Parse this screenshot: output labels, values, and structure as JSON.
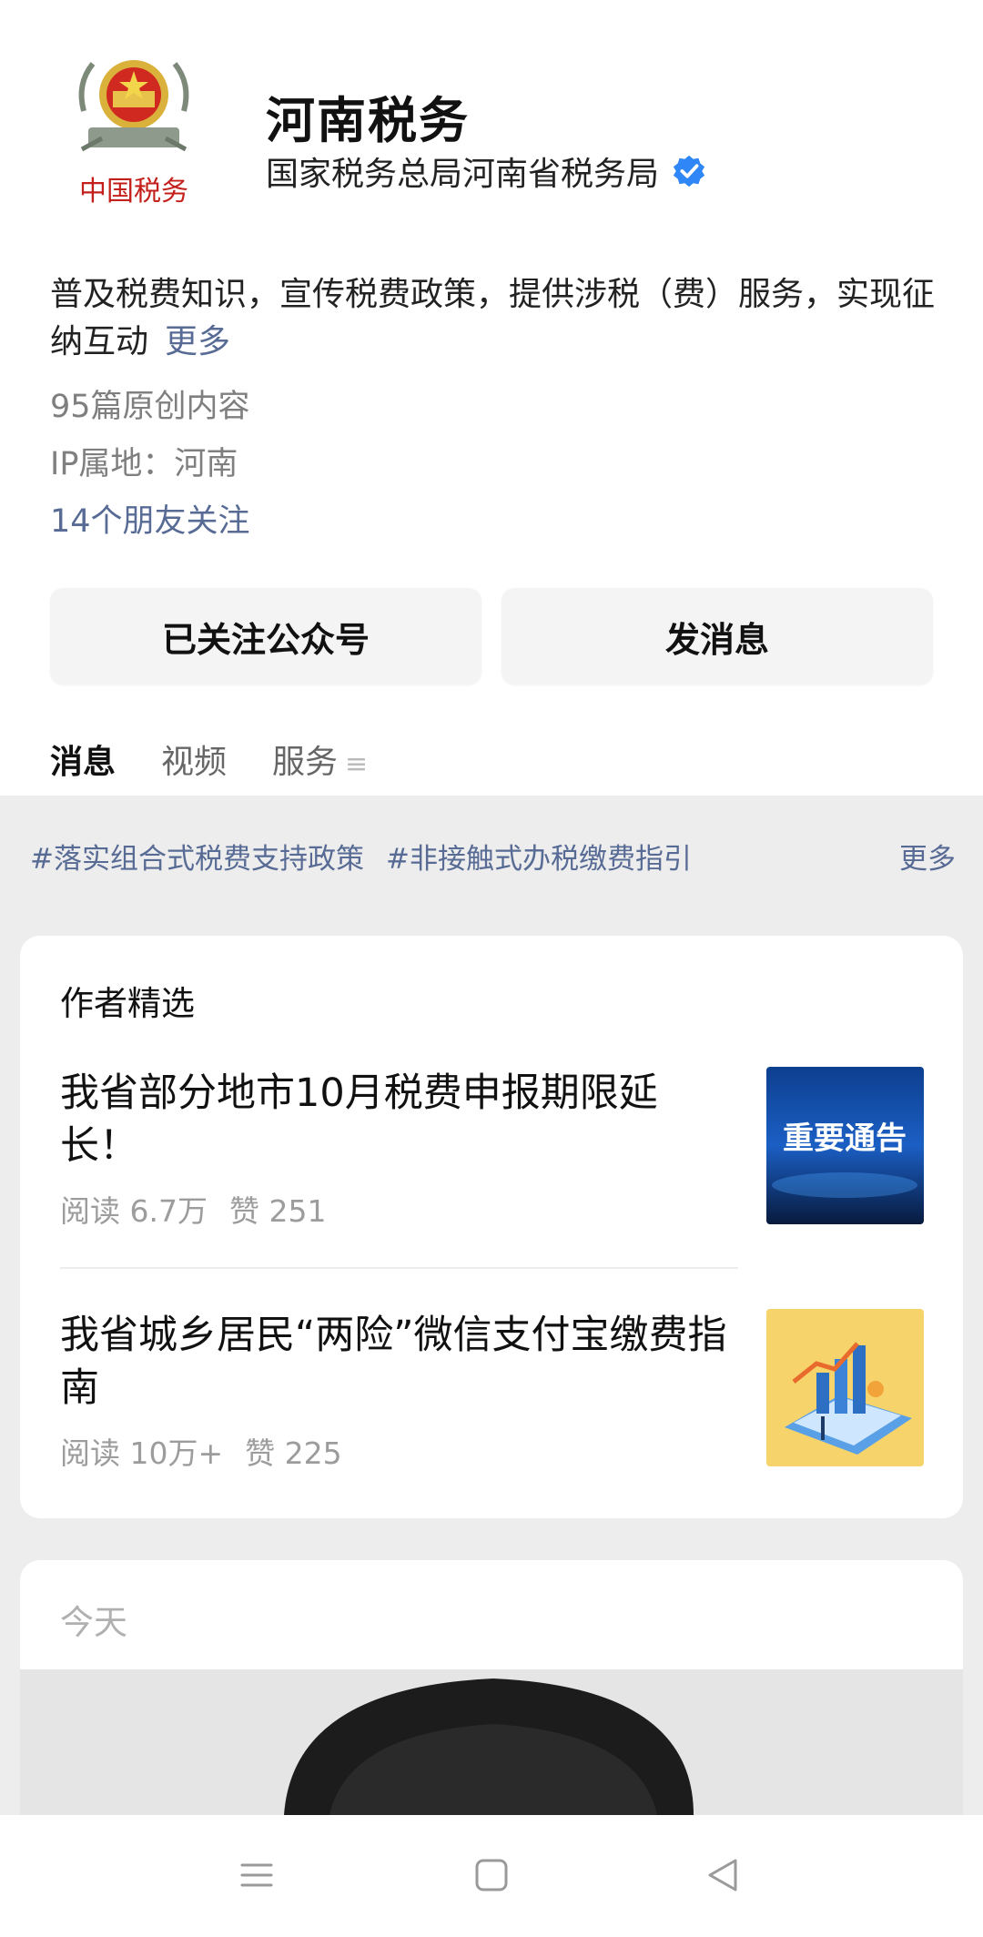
{
  "account": {
    "name": "河南税务",
    "org": "国家税务总局河南省税务局",
    "logo_text": "中国税务",
    "verified_icon": "verified-badge-icon"
  },
  "profile": {
    "description": "普及税费知识，宣传税费政策，提供涉税（费）服务，实现征纳互动",
    "more_label": "更多",
    "original_count": "95篇原创内容",
    "ip_location": "IP属地：河南",
    "friends_following": "14个朋友关注"
  },
  "actions": {
    "followed_label": "已关注公众号",
    "message_label": "发消息"
  },
  "tabs": [
    {
      "label": "消息",
      "active": true
    },
    {
      "label": "视频",
      "active": false
    },
    {
      "label": "服务",
      "active": false
    }
  ],
  "topics": {
    "items": [
      "#落实组合式税费支持政策",
      "#非接触式办税缴费指引"
    ],
    "more_label": "更多"
  },
  "featured": {
    "section_title": "作者精选",
    "articles": [
      {
        "title": "我省部分地市10月税费申报期限延长！",
        "reads": "阅读 6.7万",
        "likes": "赞 251",
        "thumb_text": "重要通告"
      },
      {
        "title": "我省城乡居民“两险”微信支付宝缴费指南",
        "reads": "阅读 10万+",
        "likes": "赞 225",
        "thumb_text": ""
      }
    ]
  },
  "feed": {
    "date_label": "今天"
  },
  "colors": {
    "link": "#576b95",
    "background_gray": "#ededed",
    "verified_blue": "#2f86f6"
  }
}
